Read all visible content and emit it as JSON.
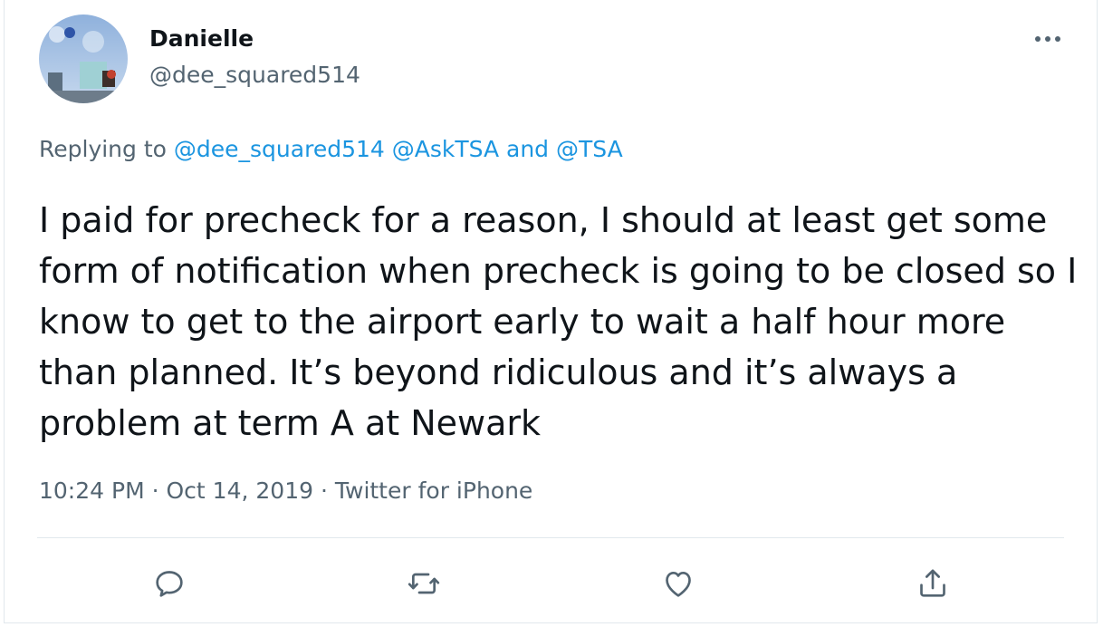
{
  "author": {
    "name": "Danielle",
    "handle": "@dee_squared514"
  },
  "menu": {
    "more_icon": "more-horizontal-icon"
  },
  "reply": {
    "prefix": "Replying to",
    "mentions": [
      "@dee_squared514",
      "@AskTSA"
    ],
    "and_word": "and",
    "last_mention": "@TSA"
  },
  "tweet": {
    "text": "I paid for precheck for a reason, I should at least get some form of notification when precheck is going to be closed so I know to get to the airport early to wait a half hour more than planned. It’s beyond ridiculous and it’s always a problem at term A at Newark"
  },
  "meta": {
    "time": "10:24 PM",
    "separator": "·",
    "date": "Oct 14, 2019",
    "source": "Twitter for iPhone"
  },
  "actions": [
    "reply-icon",
    "retweet-icon",
    "like-icon",
    "share-icon"
  ],
  "colors": {
    "link": "#1b95e0",
    "secondary_text": "#536471",
    "icon": "#536471",
    "border": "#e1e8ed"
  }
}
